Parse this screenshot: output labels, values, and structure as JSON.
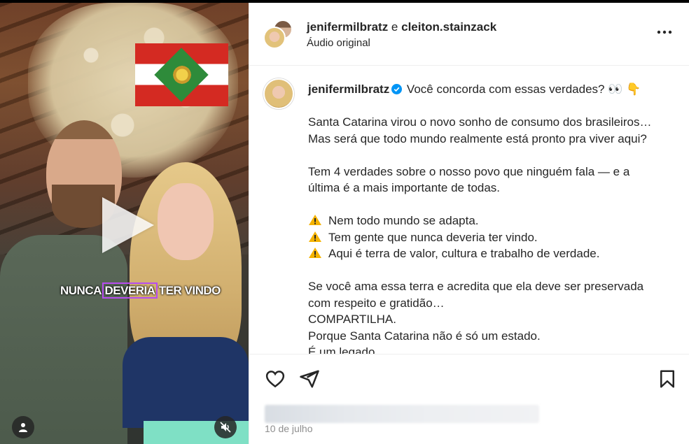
{
  "video": {
    "caption_overlay": {
      "before": "NUNCA ",
      "highlight": "DEVERIA",
      "after": " TER VINDO"
    },
    "icons": [
      "play-icon",
      "user-icon",
      "mute-icon"
    ]
  },
  "header": {
    "user1": "jenifermilbratz",
    "joiner": " e ",
    "user2": "cleiton.stainzack",
    "subtitle": "Áudio original",
    "more_icon": "more-options-icon"
  },
  "caption": {
    "username": "jenifermilbratz",
    "verified": true,
    "first_line": " Você concorda com essas verdades? 👀 👇",
    "para1": [
      "Santa Catarina virou o novo sonho de consumo dos brasileiros…",
      "Mas será que todo mundo realmente está pronto pra viver aqui?"
    ],
    "para2": [
      "Tem 4 verdades sobre o nosso povo que ninguém fala — e a",
      "última é a mais importante de todas."
    ],
    "bullets": [
      "Nem todo mundo se adapta.",
      "Tem gente que nunca deveria ter vindo.",
      "Aqui é terra de valor, cultura e trabalho de verdade."
    ],
    "para3": [
      "Se você ama essa terra e acredita que ela deve ser preservada",
      "com respeito e gratidão…",
      "COMPARTILHA.",
      "Porque Santa Catarina não é só um estado.",
      "É um legado."
    ]
  },
  "actions": {
    "icons": [
      "heart-icon",
      "share-icon",
      "bookmark-icon"
    ],
    "date": "10 de julho"
  },
  "colors": {
    "text": "#262626",
    "muted": "#8e8e8e",
    "verified": "#0095f6",
    "warning": "#f5b300",
    "highlight_outline": "#b74cf0"
  }
}
